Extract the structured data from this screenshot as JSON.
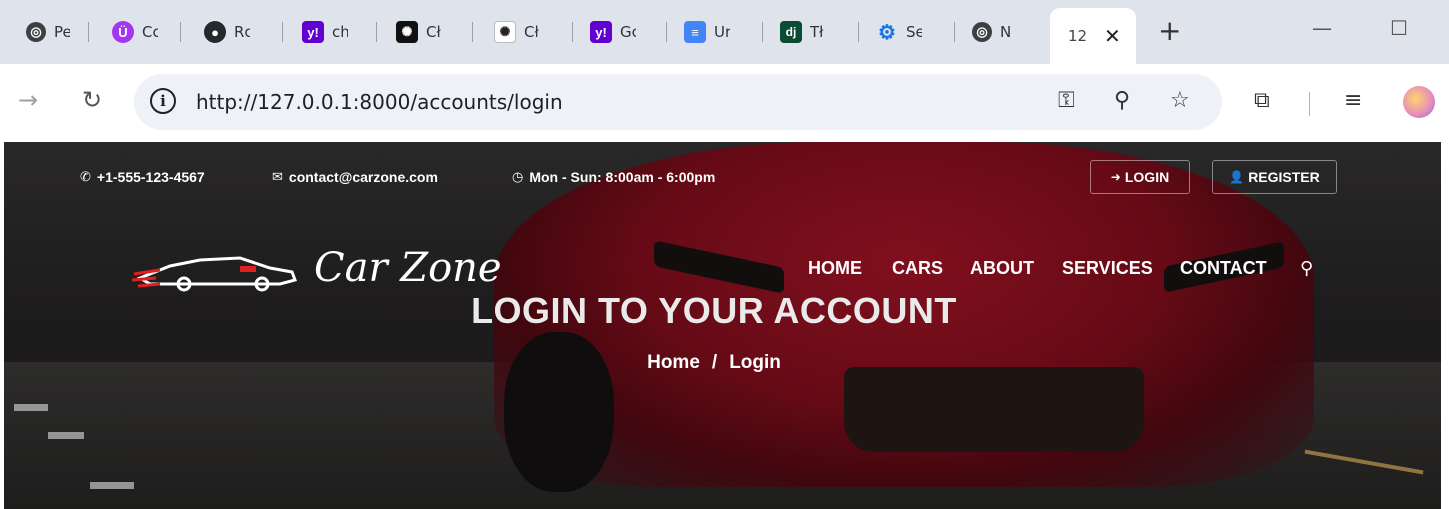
{
  "browser": {
    "tabs": [
      {
        "title": "Pe",
        "icon": "globe-icon",
        "color": "#3c4043"
      },
      {
        "title": "Cc",
        "icon": "udemy-icon",
        "color": "#a435f0"
      },
      {
        "title": "Rc",
        "icon": "github-icon",
        "color": "#24292e"
      },
      {
        "title": "ch",
        "icon": "yahoo-icon",
        "color": "#6001d2"
      },
      {
        "title": "Cł",
        "icon": "openai-icon",
        "color": "#000000"
      },
      {
        "title": "Cł",
        "icon": "openai-icon",
        "color": "#ffffff"
      },
      {
        "title": "Gc",
        "icon": "yahoo-icon",
        "color": "#6001d2"
      },
      {
        "title": "Ur",
        "icon": "docs-icon",
        "color": "#4285f4"
      },
      {
        "title": "Tł",
        "icon": "django-icon",
        "color": "#0c4b33"
      },
      {
        "title": "Se",
        "icon": "gear-icon",
        "color": "#1a73e8"
      },
      {
        "title": "N",
        "icon": "globe-icon",
        "color": "#3c4043"
      }
    ],
    "active_tab": {
      "title": "12",
      "close": "✕"
    },
    "new_tab": "+",
    "minimize": "—",
    "maximize": "☐",
    "url": "http://127.0.0.1:8000/accounts/login"
  },
  "site": {
    "phone": "+1-555-123-4567",
    "email": "contact@carzone.com",
    "hours": "Mon - Sun: 8:00am - 6:00pm",
    "login_label": "LOGIN",
    "register_label": "REGISTER",
    "logo_text": "Car Zone",
    "nav": [
      "HOME",
      "CARS",
      "ABOUT",
      "SERVICES",
      "CONTACT"
    ],
    "hero_title": "LOGIN TO YOUR ACCOUNT",
    "breadcrumb_home": "Home",
    "breadcrumb_sep": "/",
    "breadcrumb_current": "Login"
  }
}
